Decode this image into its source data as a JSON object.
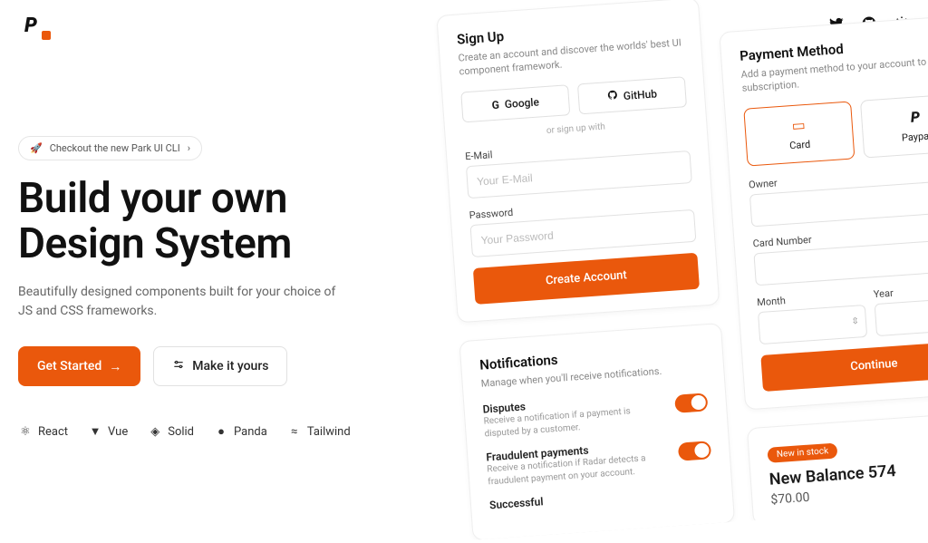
{
  "header": {
    "icons": {
      "twitter": "twitter-icon",
      "github": "github-icon",
      "theme": "sun-icon"
    }
  },
  "hero": {
    "pill": "Checkout the new Park UI CLI",
    "title_line1": "Build your own",
    "title_line2": "Design System",
    "subtitle": "Beautifully designed components built for your choice of JS and CSS frameworks.",
    "cta_primary": "Get Started",
    "cta_secondary": "Make it yours",
    "frameworks": {
      "react": "React",
      "vue": "Vue",
      "solid": "Solid",
      "panda": "Panda",
      "tailwind": "Tailwind"
    }
  },
  "signup": {
    "title": "Sign Up",
    "desc": "Create an account and discover the worlds' best UI component framework.",
    "google": "Google",
    "github": "GitHub",
    "sep": "or sign up with",
    "email_label": "E-Mail",
    "email_placeholder": "Your E-Mail",
    "password_label": "Password",
    "password_placeholder": "Your Password",
    "submit": "Create Account"
  },
  "notifications": {
    "title": "Notifications",
    "desc": "Manage when you'll receive notifications.",
    "items": [
      {
        "title": "Disputes",
        "desc": "Receive a notification if a payment is disputed by a customer."
      },
      {
        "title": "Fraudulent payments",
        "desc": "Receive a notification if Radar detects a fraudulent payment on your account."
      },
      {
        "title": "Successful",
        "desc": ""
      }
    ]
  },
  "payment": {
    "title": "Payment Method",
    "desc": "Add a payment method to your account to subscription.",
    "card": "Card",
    "paypal": "Paypal",
    "owner_label": "Owner",
    "cardnum_label": "Card Number",
    "month_label": "Month",
    "year_label": "Year",
    "submit": "Continue"
  },
  "product": {
    "badge": "New in stock",
    "title": "New Balance 574",
    "price": "$70.00"
  }
}
